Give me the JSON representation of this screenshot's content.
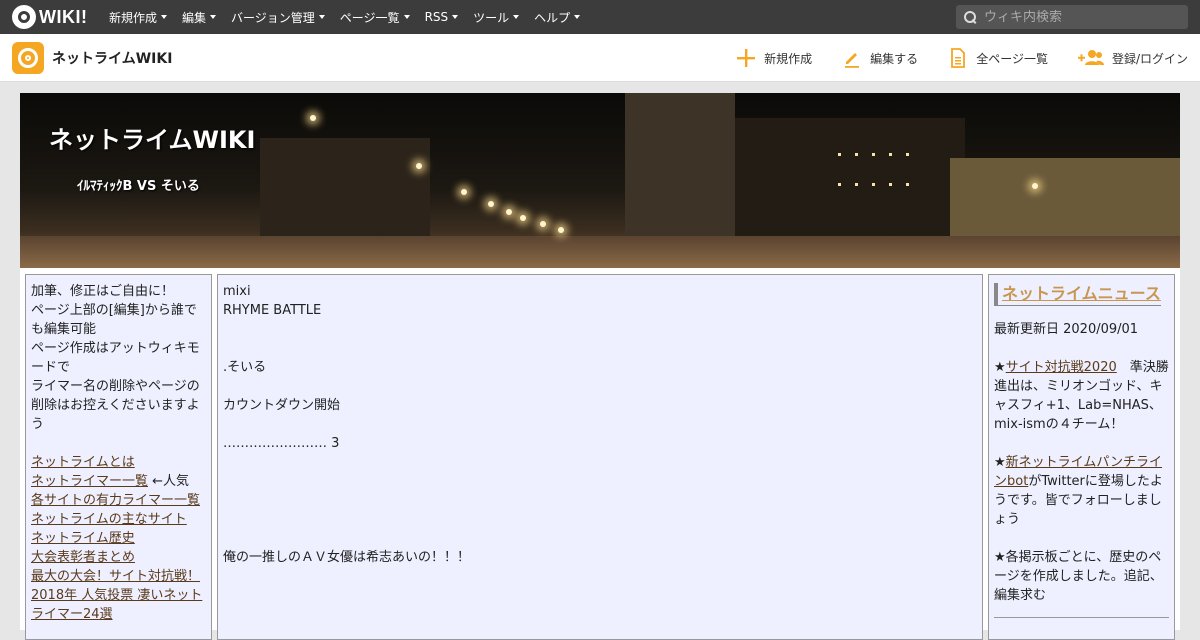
{
  "topbar": {
    "logo_text": "WIKI!",
    "menu": [
      {
        "label": "新規作成"
      },
      {
        "label": "編集"
      },
      {
        "label": "バージョン管理"
      },
      {
        "label": "ページ一覧"
      },
      {
        "label": "RSS"
      },
      {
        "label": "ツール"
      },
      {
        "label": "ヘルプ"
      }
    ],
    "search_placeholder": "ウィキ内検索"
  },
  "subbar": {
    "site_name": "ネットライムWIKI",
    "actions": [
      {
        "label": "新規作成",
        "icon": "plus-icon"
      },
      {
        "label": "編集する",
        "icon": "pencil-icon"
      },
      {
        "label": "全ページ一覧",
        "icon": "document-icon"
      },
      {
        "label": "登録/ログイン",
        "icon": "add-user-icon"
      }
    ]
  },
  "banner": {
    "title": "ネットライムWIKI",
    "subtitle": "ｲﾙﾏﾃｨｯｸB VS そいる"
  },
  "left_column": {
    "intro": "加筆、修正はご自由に！\nページ上部の[編集]から誰でも編集可能\nページ作成はアットウィキモードで\nライマー名の削除やページの削除はお控えくださいますよう",
    "links": [
      {
        "label": "ネットライムとは",
        "suffix": ""
      },
      {
        "label": "ネットライマー一覧",
        "suffix": " ←人気"
      },
      {
        "label": "各サイトの有力ライマー一覧",
        "suffix": ""
      },
      {
        "label": "ネットライムの主なサイト",
        "suffix": ""
      },
      {
        "label": "ネットライム歴史",
        "suffix": ""
      },
      {
        "label": "大会表彰者まとめ",
        "suffix": ""
      },
      {
        "label": "最大の大会！サイト対抗戦！",
        "suffix": ""
      },
      {
        "label": "2018年 人気投票 凄いネットライマー24選",
        "suffix": ""
      }
    ]
  },
  "main_column": {
    "lines": [
      "mixi",
      "RHYME BATTLE",
      "",
      "",
      ".そいる",
      "",
      "カウントダウン開始",
      "",
      "…………………… 3",
      "",
      "",
      "",
      "",
      "",
      "俺の一推しのＡＶ女優は希志あいの！！！"
    ]
  },
  "right_column": {
    "heading": "ネットライムニュース",
    "updated": "最新更新日 2020/09/01",
    "news1_prefix": "★",
    "news1_link": "サイト対抗戦2020",
    "news1_text": "　準決勝進出は、ミリオンゴッド、キャスフィ+1、Lab=NHAS、mix-ismの４チーム！",
    "news2_prefix": "★",
    "news2_link": "新ネットライムパンチラインbot",
    "news2_text": "がTwitterに登場したようです。皆でフォローしましょう",
    "news3": "★各掲示板ごとに、歴史のページを作成しました。追記、編集求む"
  },
  "colors": {
    "topbar_bg": "#3c3c3c",
    "accent_orange": "#f5a623",
    "column_bg": "#eef0ff",
    "link_color": "#5a3a1a",
    "news_heading": "#c8964e"
  }
}
